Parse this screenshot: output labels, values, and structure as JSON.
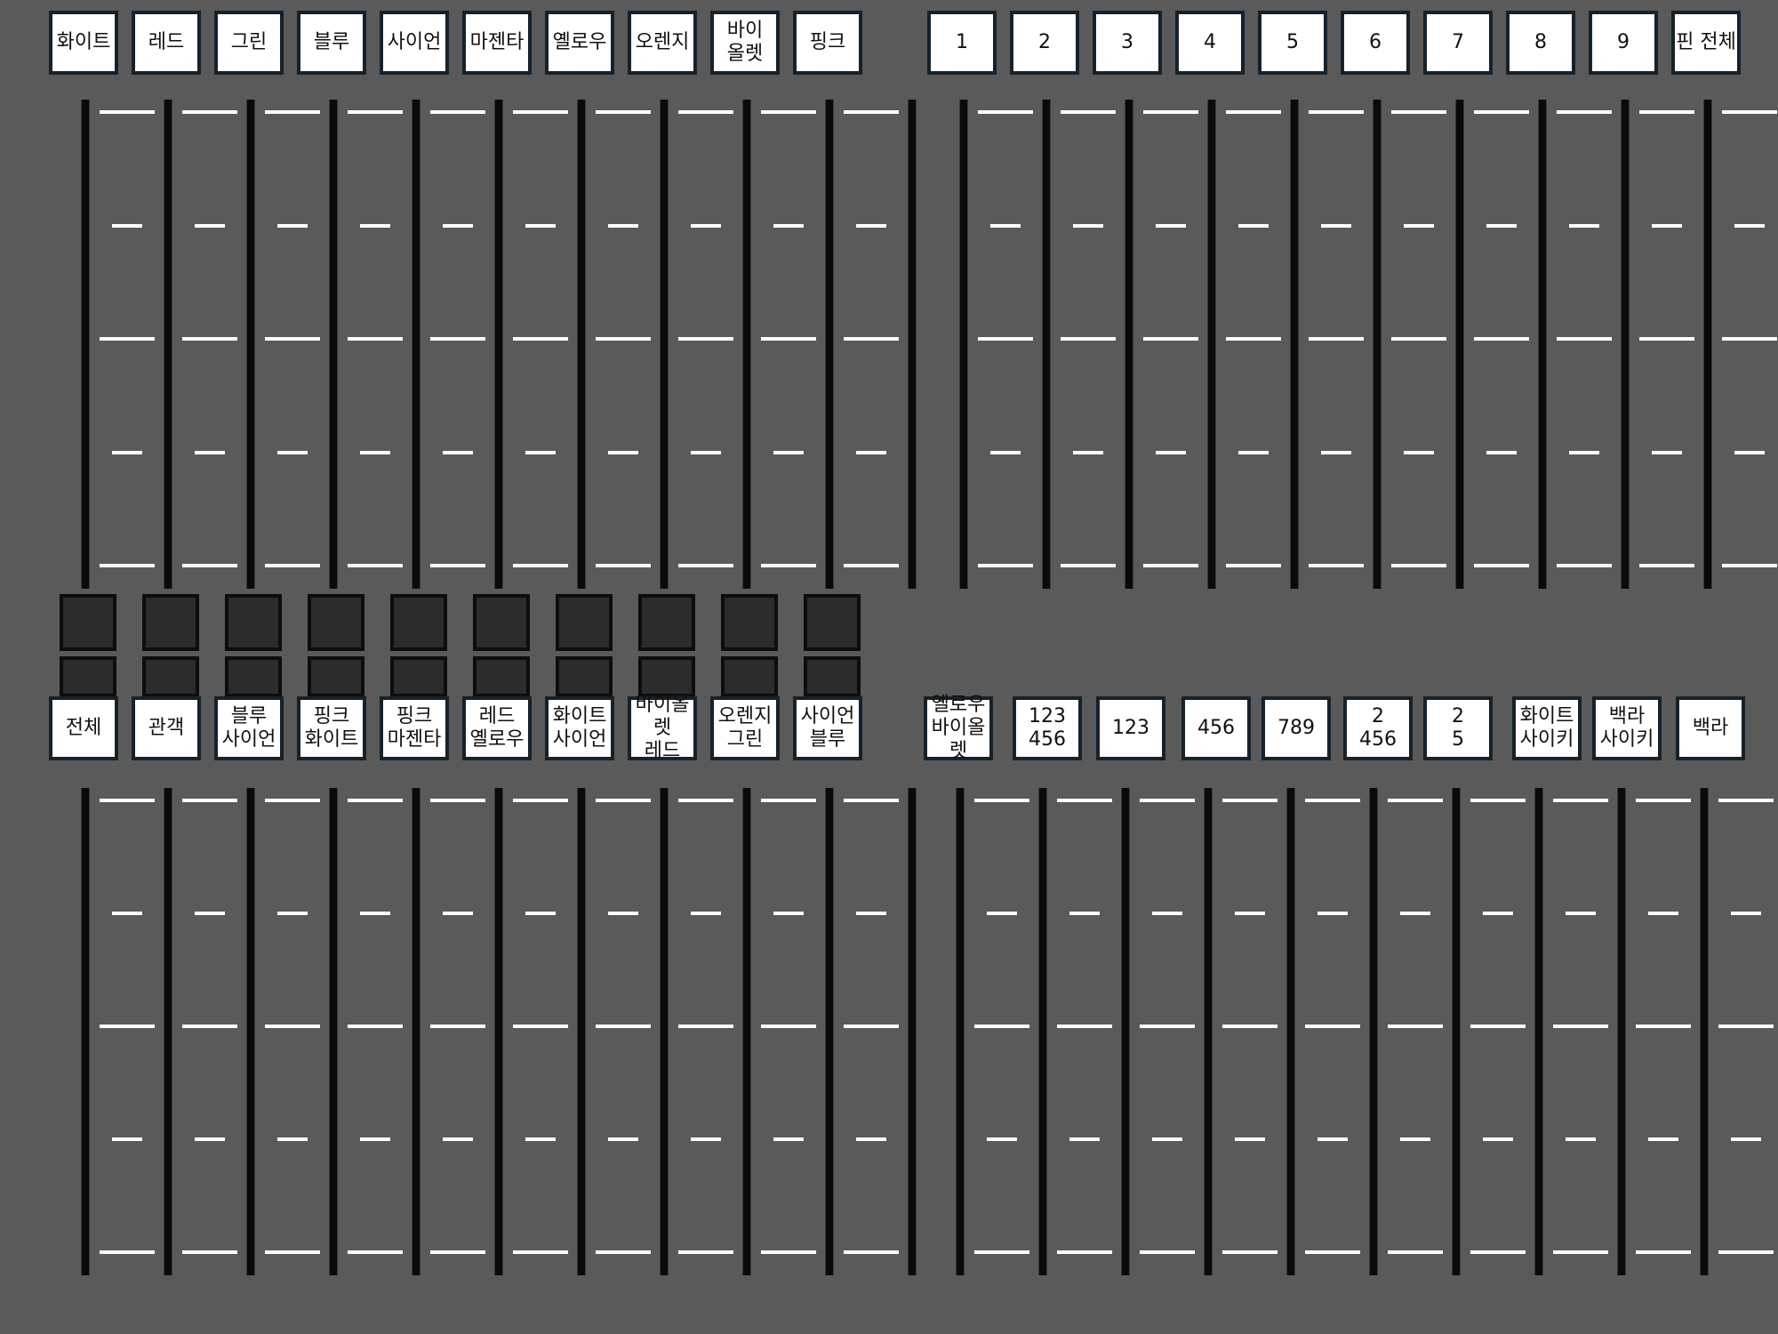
{
  "banks": [
    {
      "id": "color",
      "labels": [
        "화이트",
        "레드",
        "그린",
        "블루",
        "사이언",
        "마젠타",
        "옐로우",
        "오렌지",
        "바이\n올렛",
        "핑크"
      ]
    },
    {
      "id": "pin",
      "labels": [
        "1",
        "2",
        "3",
        "4",
        "5",
        "6",
        "7",
        "8",
        "9",
        "핀 전체"
      ]
    },
    {
      "id": "group",
      "labels": [
        "전체",
        "관객",
        "블루\n사이언",
        "핑크\n화이트",
        "핑크\n마젠타",
        "레드\n옐로우",
        "화이트\n사이언",
        "바이올렛\n레드",
        "오렌지\n그린",
        "사이언\n블루"
      ]
    },
    {
      "id": "preset",
      "labels": [
        "옐로우\n바이올렛",
        "123\n456",
        "123",
        "456",
        "789",
        "2\n456",
        "2\n5",
        "화이트\n사이키",
        "백라\n사이키",
        "백라"
      ]
    }
  ],
  "colors": {
    "background": "#5a5a5a",
    "label_border": "#15222b",
    "rail": "#0a0a0a",
    "tick": "#ffffff",
    "button": "#2c2c2c"
  }
}
